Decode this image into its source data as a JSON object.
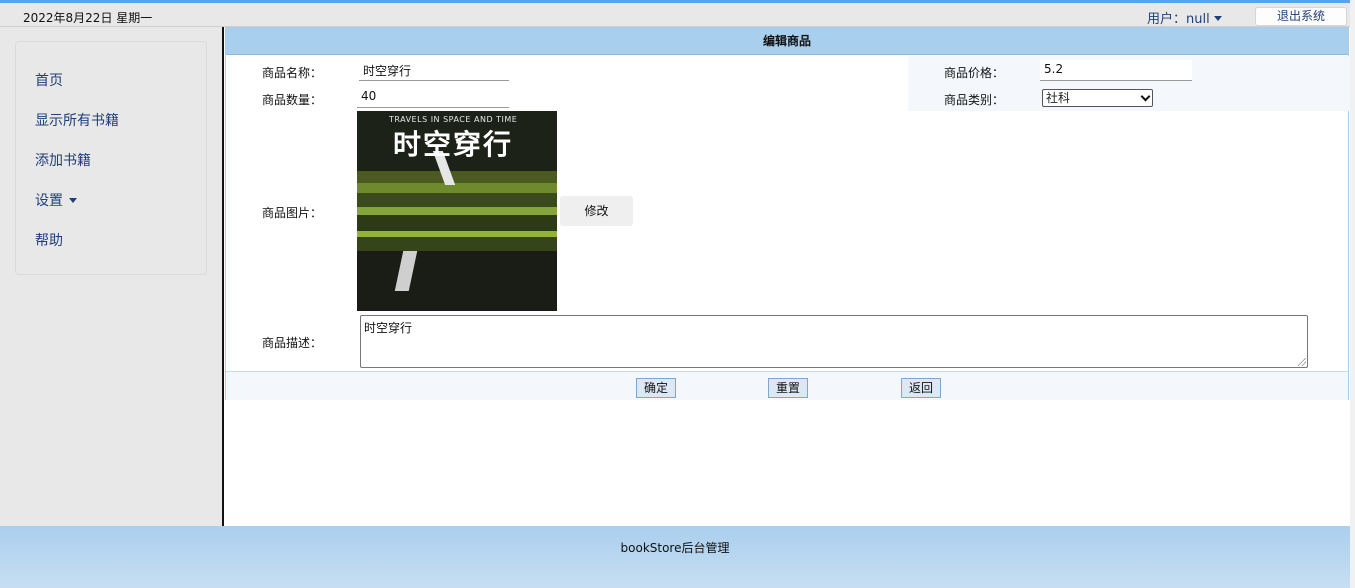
{
  "topbar": {
    "date": "2022年8月22日 星期一",
    "user_label": "用户：null",
    "logout_label": "退出系统"
  },
  "sidebar": {
    "items": [
      {
        "label": "首页"
      },
      {
        "label": "显示所有书籍"
      },
      {
        "label": "添加书籍"
      },
      {
        "label": "设置"
      },
      {
        "label": "帮助"
      }
    ]
  },
  "form": {
    "header": "编辑商品",
    "name_label": "商品名称：",
    "name_value": "时空穿行",
    "quantity_label": "商品数量：",
    "quantity_value": "40",
    "price_label": "商品价格：",
    "price_value": "5.2",
    "category_label": "商品类别：",
    "category_value": "社科",
    "image_label": "商品图片：",
    "modify_label": "修改",
    "desc_label": "商品描述：",
    "desc_value": "时空穿行",
    "confirm_label": "确定",
    "reset_label": "重置",
    "back_label": "返回"
  },
  "cover": {
    "title": "时空穿行",
    "subtitle_en": "TRAVELS IN SPACE AND TIME"
  },
  "footer": {
    "text": "bookStore后台管理"
  },
  "colors": {
    "accent": "#a9cfee",
    "link": "#1f3f7a"
  }
}
